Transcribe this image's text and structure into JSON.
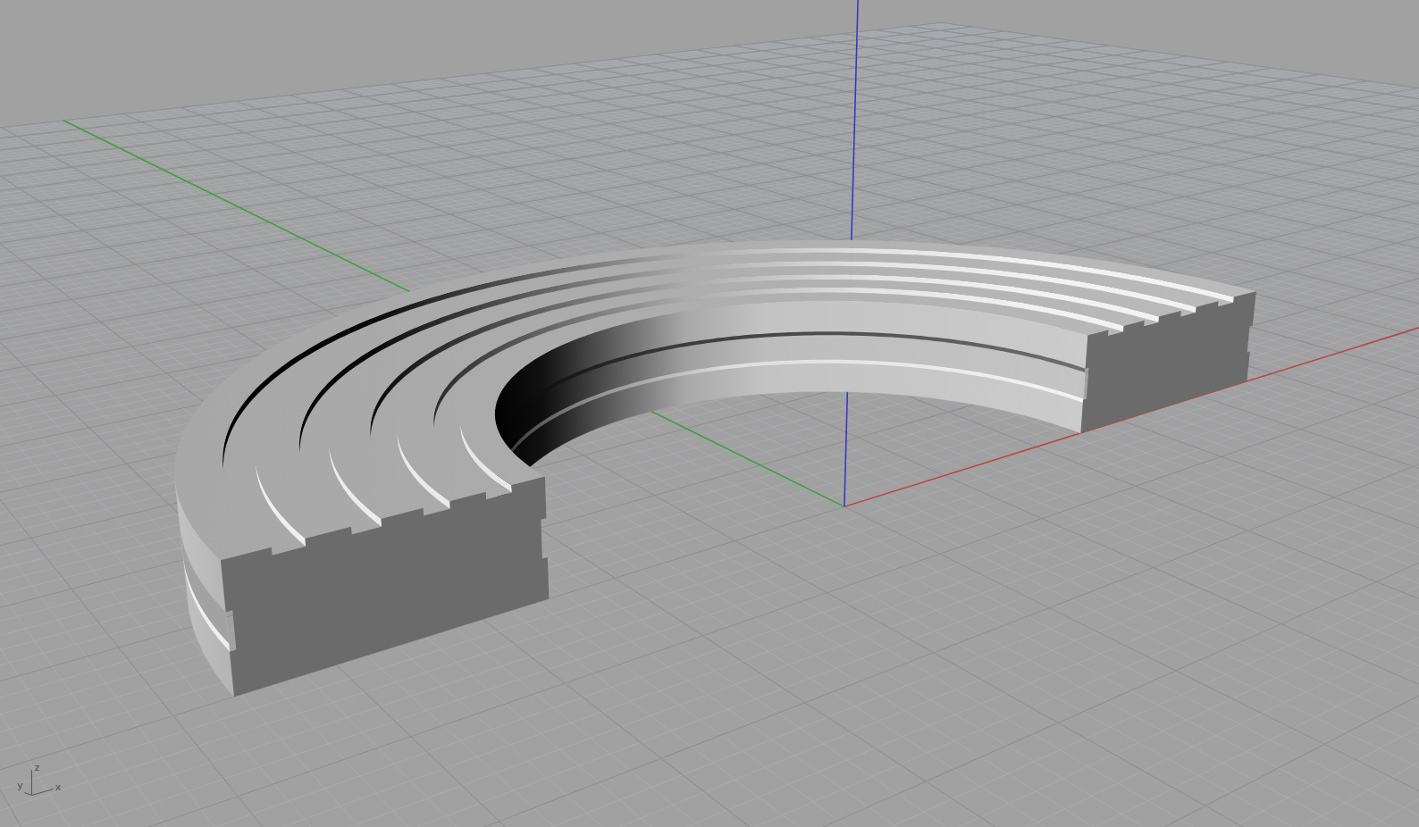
{
  "viewport": {
    "axis_triad": {
      "labels": [
        "z",
        "y",
        "x"
      ]
    }
  }
}
